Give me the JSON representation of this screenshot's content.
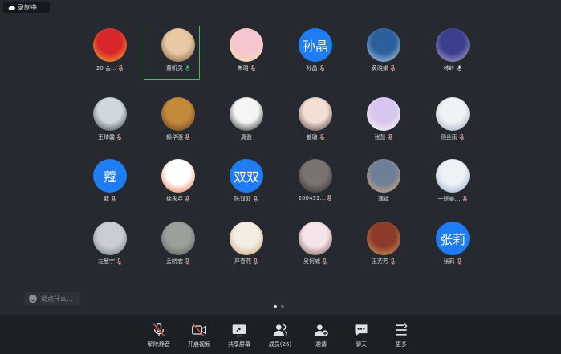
{
  "recording": {
    "label": "录制中"
  },
  "participants": [
    {
      "name": "20 会…",
      "avatar": "flag",
      "mic": "muted"
    },
    {
      "name": "董昕灵",
      "avatar": "photo-cartoon-girl",
      "mic": "active",
      "highlighted": true
    },
    {
      "name": "朱珺",
      "avatar": "photo-pink",
      "mic": "muted"
    },
    {
      "name": "孙晶",
      "avatar_text": "孙晶",
      "mic": "muted"
    },
    {
      "name": "黄晓娟",
      "avatar": "photo-sea",
      "mic": "muted"
    },
    {
      "name": "林岭",
      "avatar": "photo-stage",
      "mic": "on"
    },
    {
      "name": "王琦馨",
      "avatar": "photo-girl",
      "mic": "muted"
    },
    {
      "name": "赖华强",
      "avatar": "photo-beads",
      "mic": "muted"
    },
    {
      "name": "周盈",
      "avatar": "photo-calligraphy",
      "mic": "none"
    },
    {
      "name": "姜璐",
      "avatar": "photo-woman",
      "mic": "muted"
    },
    {
      "name": "张慧",
      "avatar": "photo-bunny",
      "mic": "muted"
    },
    {
      "name": "顾丝雨",
      "avatar": "photo-cartoon",
      "mic": "muted"
    },
    {
      "name": "蔻",
      "avatar_text": "蔻",
      "mic": "muted"
    },
    {
      "name": "徐永兵",
      "avatar": "photo-logo",
      "mic": "muted"
    },
    {
      "name": "陈双双",
      "avatar_text": "双双",
      "mic": "muted"
    },
    {
      "name": "200431…",
      "avatar": "photo-rider",
      "mic": "muted"
    },
    {
      "name": "蒲斌",
      "avatar": "photo-sunset",
      "mic": "none"
    },
    {
      "name": "一班姜…",
      "avatar": "photo-illustration",
      "mic": "muted"
    },
    {
      "name": "左慧宇",
      "avatar": "photo-beach",
      "mic": "muted"
    },
    {
      "name": "孟晓宏",
      "avatar": "photo-lake",
      "mic": "muted"
    },
    {
      "name": "严春燕",
      "avatar": "photo-cat",
      "mic": "muted"
    },
    {
      "name": "吴钶威",
      "avatar": "photo-anime-girl",
      "mic": "muted"
    },
    {
      "name": "王芳芳",
      "avatar": "photo-group",
      "mic": "muted"
    },
    {
      "name": "张莉",
      "avatar_text": "张莉",
      "mic": "muted"
    }
  ],
  "chat": {
    "placeholder": "说点什么…"
  },
  "pager": {
    "total": 2,
    "current": 1
  },
  "toolbar": {
    "unmute": "解除静音",
    "start_video": "开启视频",
    "share_screen": "共享屏幕",
    "members": "成员(26)",
    "invite": "邀请",
    "chat": "聊天",
    "more": "更多"
  },
  "colors": {
    "background": "#262a30",
    "toolbar": "#1c1f24",
    "accent_blue": "#1f7cf2",
    "active_green": "#36c25a"
  }
}
